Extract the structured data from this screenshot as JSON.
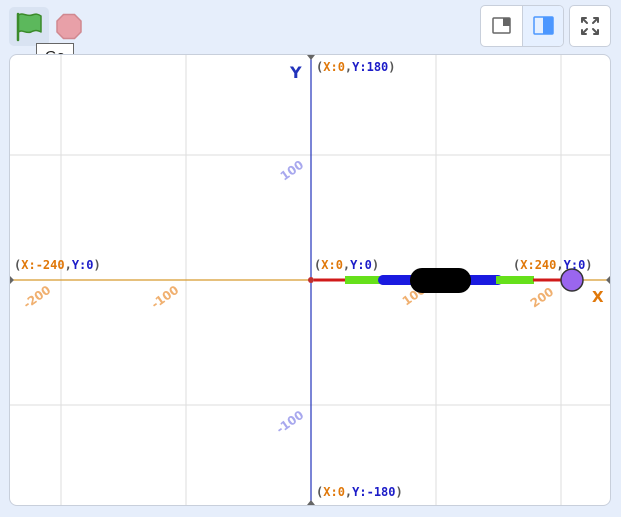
{
  "toolbar": {
    "flag_icon": "green-flag-icon",
    "stop_icon": "stop-icon",
    "tooltip": "Go",
    "layout_small_icon": "small-stage-icon",
    "layout_normal_icon": "normal-stage-icon",
    "fullscreen_icon": "fullscreen-icon"
  },
  "stage": {
    "y_axis_label": "Y",
    "x_axis_label": "X",
    "x_ticks": [
      "-200",
      "-100",
      "100",
      "200"
    ],
    "y_ticks": [
      "100",
      "-100"
    ],
    "coords": {
      "top": {
        "x": "0",
        "y": "180"
      },
      "bottom": {
        "x": "0",
        "y": "-180"
      },
      "left": {
        "x": "-240",
        "y": "0"
      },
      "right": {
        "x": "240",
        "y": "0"
      },
      "center": {
        "x": "0",
        "y": "0"
      }
    },
    "prefix_x": "X:",
    "prefix_y": "Y:",
    "colors": {
      "x_prefix": "#e0780a",
      "y_prefix": "#1c1cc8",
      "x_axis": "#d89b2e",
      "y_axis": "#2233bb",
      "grid": "#dddddd",
      "tick_label": "#f0b070",
      "y_tick_label": "#a8a8ee",
      "sprite_circle": "#9a66ee"
    }
  }
}
